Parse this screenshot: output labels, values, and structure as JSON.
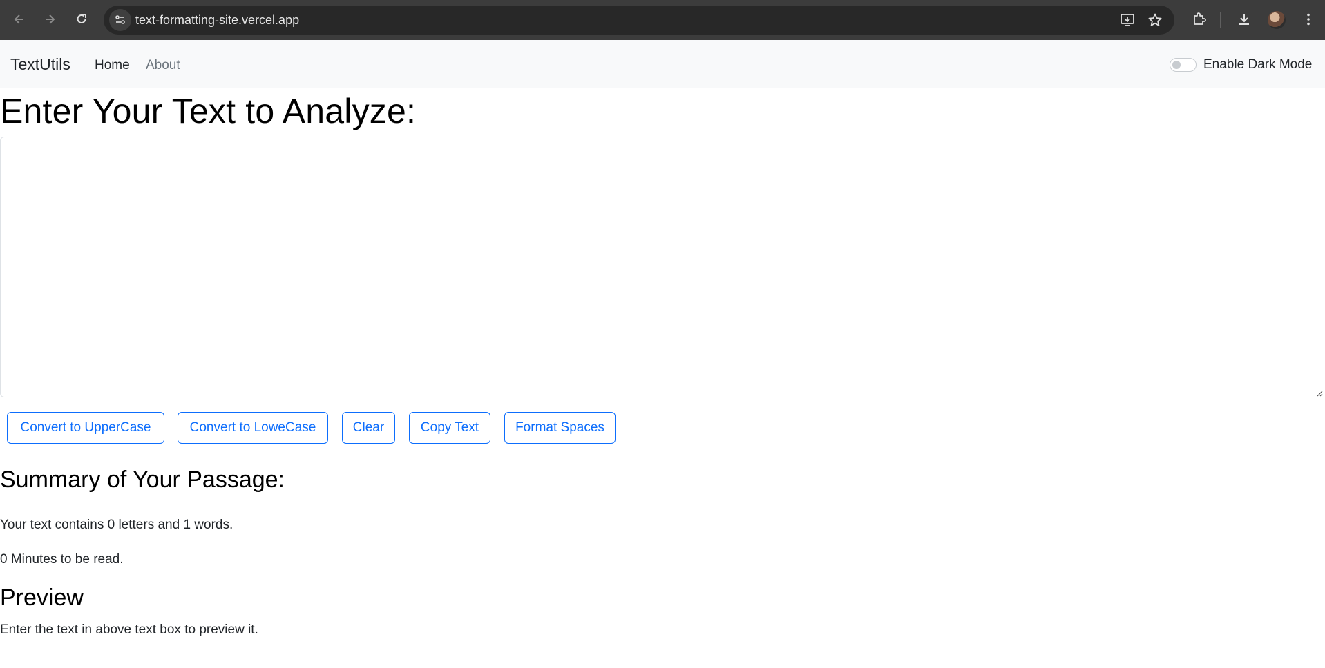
{
  "browser": {
    "url": "text-formatting-site.vercel.app",
    "icons": [
      "back-arrow-icon",
      "forward-arrow-icon",
      "reload-icon",
      "site-info-icon",
      "install-app-icon",
      "bookmark-star-icon",
      "extensions-icon",
      "download-icon",
      "profile-avatar",
      "more-menu-icon"
    ]
  },
  "navbar": {
    "brand": "TextUtils",
    "links": [
      "Home",
      "About"
    ],
    "dark_mode_label": "Enable Dark Mode",
    "dark_mode_enabled": false
  },
  "main": {
    "heading": "Enter Your Text to Analyze:",
    "textarea_value": "",
    "buttons": {
      "upper": "Convert to UpperCase",
      "lower": "Convert to LoweCase",
      "clear": "Clear",
      "copy": "Copy Text",
      "format": "Format Spaces"
    }
  },
  "summary": {
    "heading": "Summary of Your Passage:",
    "counts_text": "Your text contains 0 letters and 1 words.",
    "read_time_text": "0 Minutes to be read."
  },
  "preview": {
    "heading": "Preview",
    "text": "Enter the text in above text box to preview it."
  },
  "colors": {
    "primary": "#0d6efd",
    "navbar_bg": "#f8f9fa",
    "chrome_bg": "#3c3c3c"
  }
}
